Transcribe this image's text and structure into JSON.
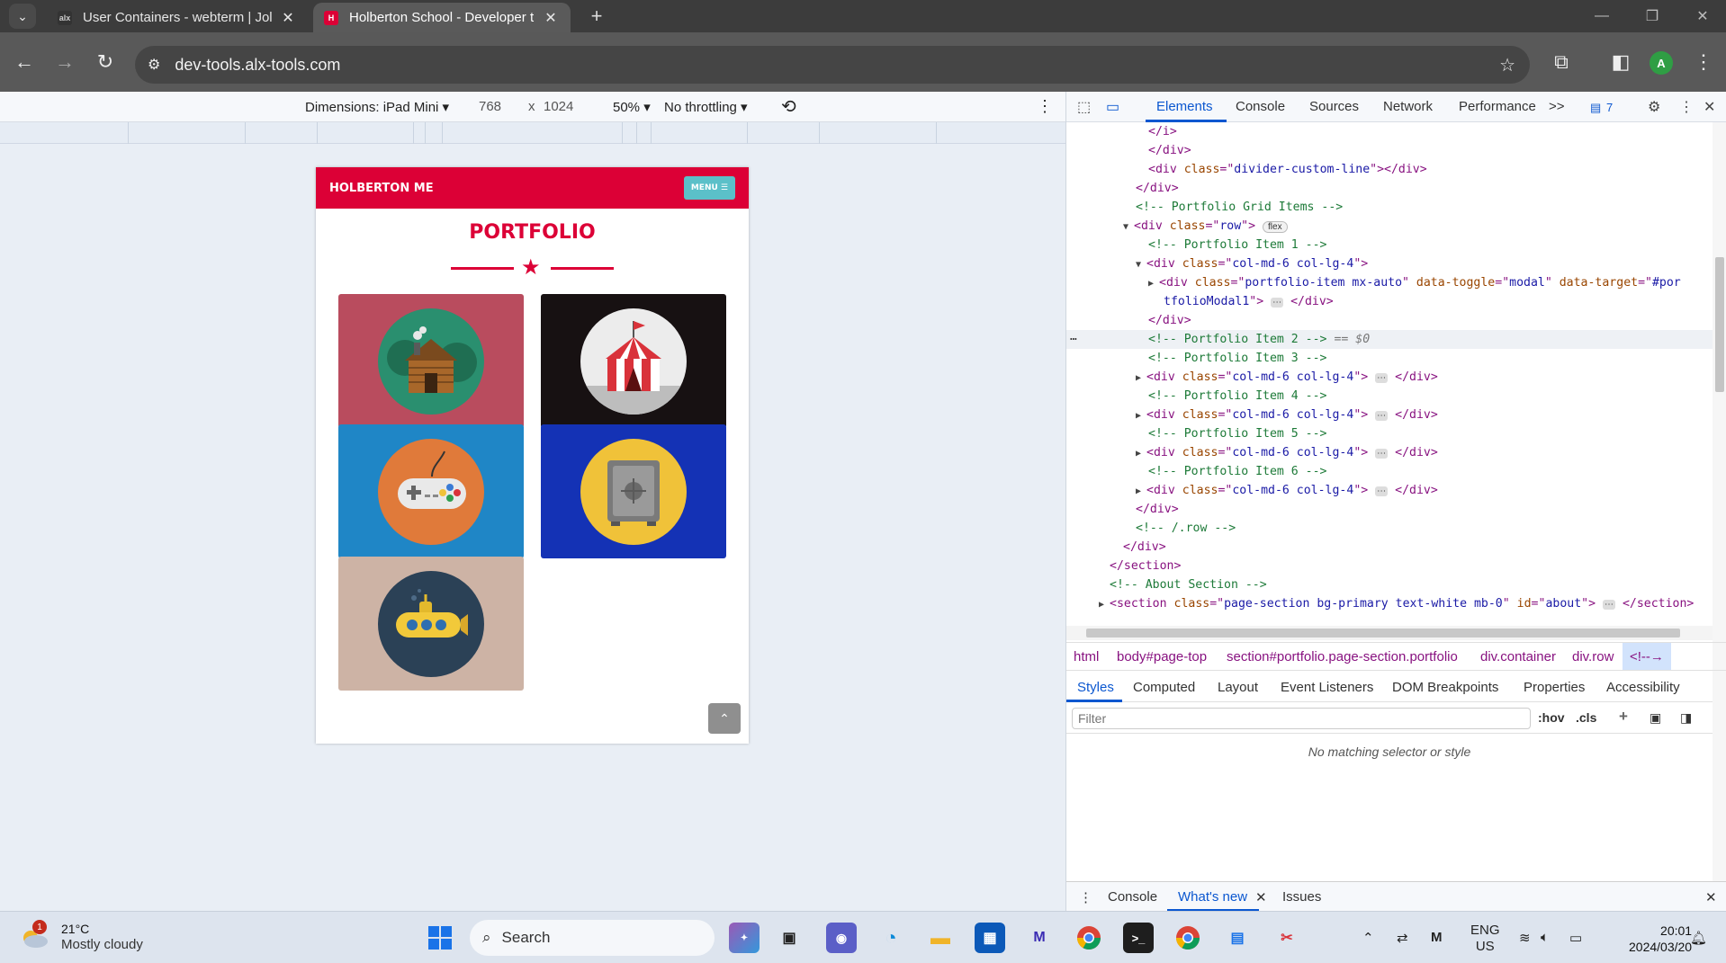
{
  "browser": {
    "tabs": [
      {
        "title": "User Containers - webterm | Jol",
        "favicon": "alx",
        "active": false
      },
      {
        "title": "Holberton School - Developer t",
        "favicon": "H",
        "active": true
      }
    ],
    "url": "dev-tools.alx-tools.com",
    "profile_initial": "A"
  },
  "device_toolbar": {
    "dimensions_label": "Dimensions: iPad Mini ▾",
    "width": "768",
    "times": "x",
    "height": "1024",
    "zoom": "50% ▾",
    "throttling": "No throttling ▾"
  },
  "page": {
    "brand": "HOLBERTON ME",
    "menu_label": "MENU ☰",
    "section_title": "PORTFOLIO",
    "items": [
      {
        "name": "cabin",
        "bg": "#b94c5e",
        "circle": "#2a8f6f"
      },
      {
        "name": "circus",
        "bg": "#171112",
        "circle": "#ececec"
      },
      {
        "name": "game",
        "bg": "#1f86c6",
        "circle": "#e07a3a"
      },
      {
        "name": "safe",
        "bg": "#1432b5",
        "circle": "#f0c239"
      },
      {
        "name": "submarine",
        "bg": "#cdb3a5",
        "circle": "#2b4156"
      }
    ]
  },
  "devtools": {
    "tabs": [
      "Elements",
      "Console",
      "Sources",
      "Network",
      "Performance"
    ],
    "more": ">>",
    "issues_count": "7",
    "breadcrumbs": [
      "html",
      "body#page-top",
      "section#portfolio.page-section.portfolio",
      "div.container",
      "div.row",
      "<!--→"
    ],
    "style_tabs": [
      "Styles",
      "Computed",
      "Layout",
      "Event Listeners",
      "DOM Breakpoints",
      "Properties",
      "Accessibility"
    ],
    "filter_placeholder": "Filter",
    "hov": ":hov",
    "cls": ".cls",
    "no_match": "No matching selector or style",
    "drawer_tabs": [
      "Console",
      "What's new",
      "Issues"
    ],
    "code": {
      "l1": "</i>",
      "l2": "</div>",
      "l3a": "<div ",
      "l3b": "class",
      "l3c": "=\"",
      "l3d": "divider-custom-line",
      "l3e": "\"></div>",
      "l4": "</div>",
      "l5": "<!-- Portfolio Grid Items -->",
      "l6a": "<div ",
      "l6b": "class",
      "l6d": "row",
      "l6e": "\">",
      "l6f": "flex",
      "l7": "<!-- Portfolio Item 1 -->",
      "l8a": "<div ",
      "l8b": "class",
      "l8d": "col-md-6 col-lg-4",
      "l8e": "\">",
      "l9a": "<div ",
      "l9b": "class",
      "l9d": "portfolio-item mx-auto",
      "l9g": "data-toggle",
      "l9h": "modal",
      "l9i": "data-target",
      "l9j": "#por",
      "l10a": "tfolioModal1",
      "l10b": "\">",
      "l10c": "⋯",
      "l10d": "</div>",
      "l11": "</div>",
      "l12a": "<!-- Portfolio Item 2 -->",
      "l12b": " == $0",
      "l13": "<!-- Portfolio Item 3 -->",
      "l14": "<div class=\"col-md-6 col-lg-4\">",
      "l15": "<!-- Portfolio Item 4 -->",
      "l17": "<!-- Portfolio Item 5 -->",
      "l19": "<!-- Portfolio Item 6 -->",
      "closediv": "</div>",
      "l21": "</div>",
      "l22": "<!-- /.row -->",
      "l23": "</div>",
      "l24": "</section>",
      "l25": "<!-- About Section -->",
      "l26a": "<section ",
      "l26b": "class",
      "l26d": "page-section bg-primary text-white mb-0",
      "l26g": "id",
      "l26h": "about",
      "l26k": "</section>"
    }
  },
  "taskbar": {
    "weather_temp": "21°C",
    "weather_desc": "Mostly cloudy",
    "weather_badge": "1",
    "search": "Search",
    "lang1": "ENG",
    "lang2": "US",
    "time": "20:01",
    "date": "2024/03/20"
  }
}
